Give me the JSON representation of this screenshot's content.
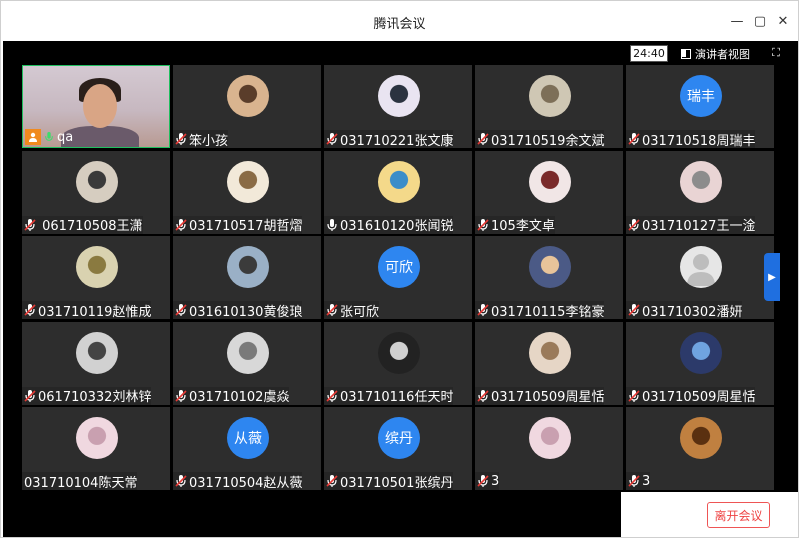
{
  "window": {
    "title": "腾讯会议",
    "controls": [
      "minimize",
      "maximize",
      "close"
    ]
  },
  "topbar": {
    "clock": "24:40",
    "view_label": "演讲者视图"
  },
  "tiles": [
    {
      "name": "qa",
      "avatar": "camera-video",
      "mic": "on",
      "self": true
    },
    {
      "name": "笨小孩",
      "avatar": "photo",
      "mic": "muted"
    },
    {
      "name": "031710221张文康",
      "avatar": "photo",
      "mic": "muted"
    },
    {
      "name": "031710519余文斌",
      "avatar": "photo",
      "mic": "muted"
    },
    {
      "name": "031710518周瑞丰",
      "avatar_text": "瑞丰",
      "mic": "muted"
    },
    {
      "name": " 061710508王潇",
      "avatar": "photo",
      "mic": "muted"
    },
    {
      "name": "031710517胡哲熠",
      "avatar": "photo",
      "mic": "muted"
    },
    {
      "name": "031610120张闻锐",
      "avatar": "photo",
      "mic": "on"
    },
    {
      "name": "105李文卓",
      "avatar": "photo",
      "mic": "muted"
    },
    {
      "name": "031710127王一淦",
      "avatar": "photo",
      "mic": "muted"
    },
    {
      "name": "031710119赵惟成",
      "avatar": "photo",
      "mic": "muted"
    },
    {
      "name": "031610130黄俊琅",
      "avatar": "photo",
      "mic": "muted"
    },
    {
      "name": "张可欣",
      "avatar_text": "可欣",
      "mic": "muted"
    },
    {
      "name": "031710115李铭豪",
      "avatar": "photo",
      "mic": "muted"
    },
    {
      "name": "031710302潘妍",
      "avatar": "default",
      "mic": "muted"
    },
    {
      "name": "061710332刘林锌",
      "avatar": "photo",
      "mic": "muted"
    },
    {
      "name": "031710102虞焱",
      "avatar": "photo",
      "mic": "muted"
    },
    {
      "name": "031710116任天时",
      "avatar": "photo",
      "mic": "muted"
    },
    {
      "name": "031710509周星恬",
      "avatar": "photo",
      "mic": "muted"
    },
    {
      "name": "031710509周星恬",
      "avatar": "photo",
      "mic": "muted"
    },
    {
      "name": "031710104陈天常",
      "avatar": "photo",
      "mic": "none"
    },
    {
      "name": "031710504赵从薇",
      "avatar_text": "从薇",
      "mic": "muted"
    },
    {
      "name": "031710501张缤丹",
      "avatar_text": "缤丹",
      "mic": "muted"
    },
    {
      "name": "3",
      "avatar": "photo",
      "mic": "muted"
    },
    {
      "name": "3",
      "avatar": "photo",
      "mic": "muted"
    }
  ],
  "leave_button": "离开会议",
  "colors": {
    "accent": "#2e86f0",
    "active_border": "#1fbf5f",
    "leave": "#e44444"
  }
}
